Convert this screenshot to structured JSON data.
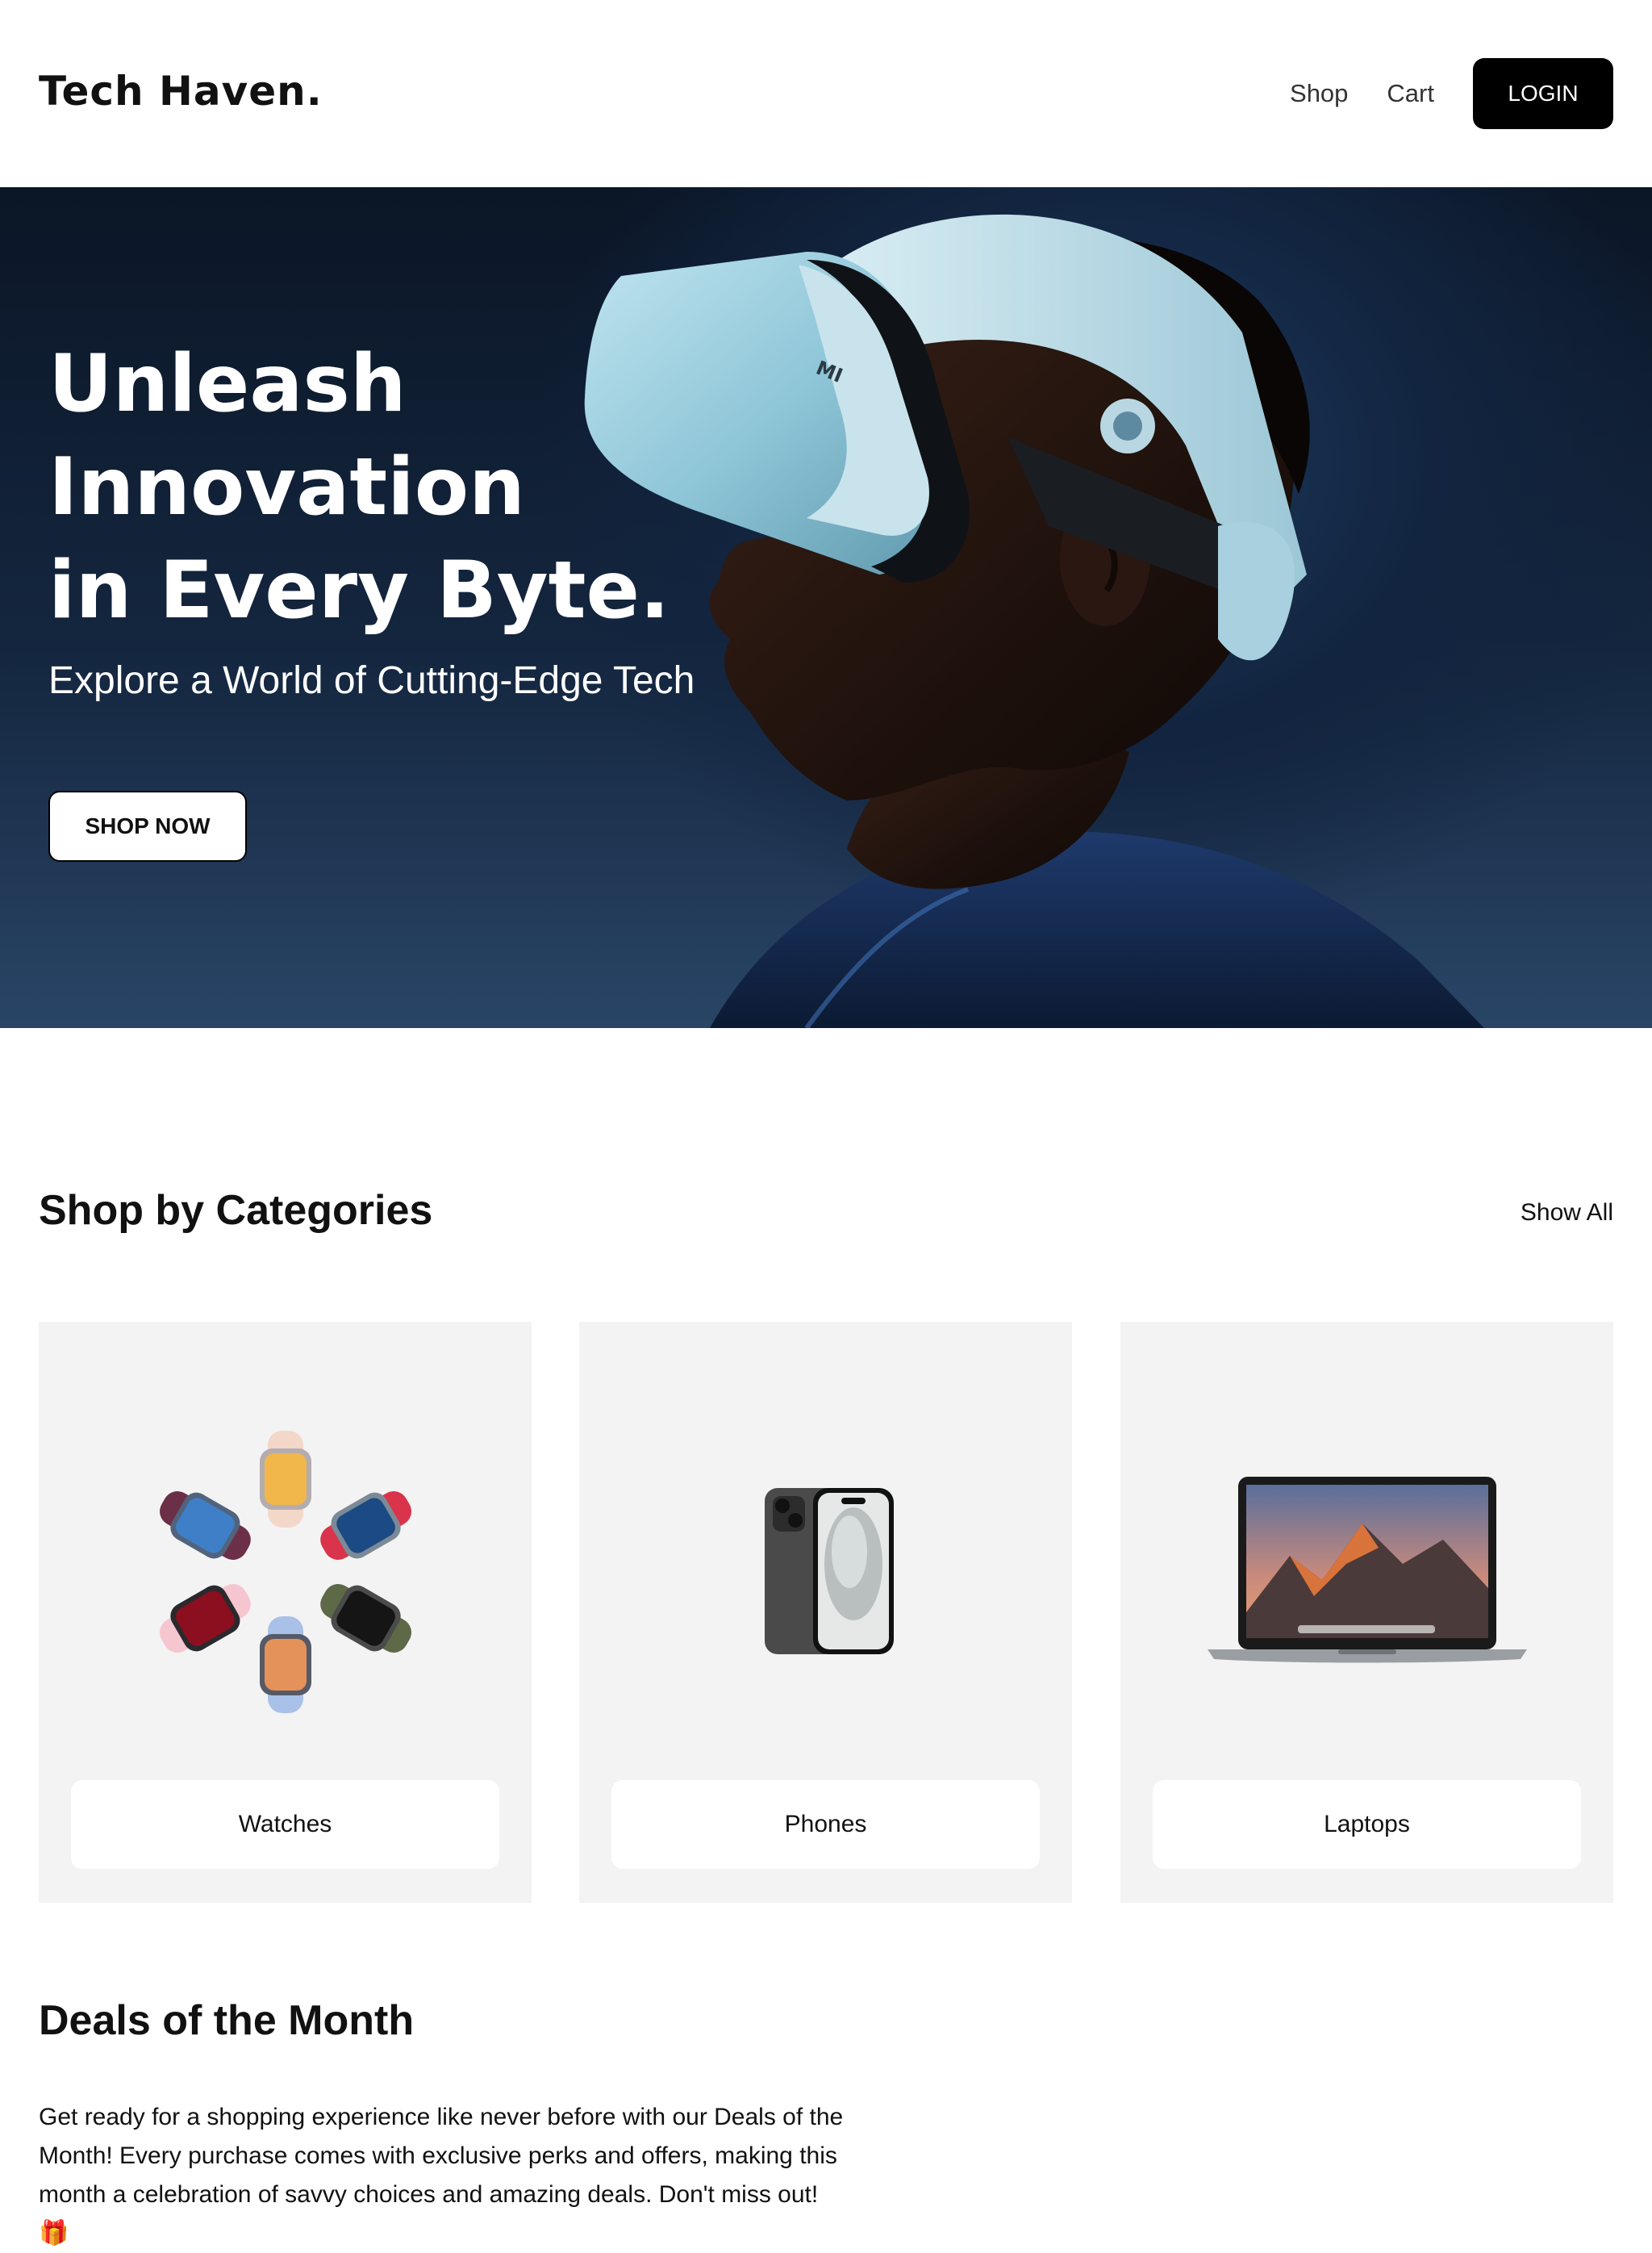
{
  "header": {
    "logo": "Tech Haven.",
    "nav": {
      "shop": "Shop",
      "cart": "Cart"
    },
    "login_label": "LOGIN"
  },
  "hero": {
    "title": "Unleash\nInnovation\nin Every Byte.",
    "subtitle": "Explore a World of Cutting-Edge Tech",
    "cta_label": "SHOP NOW",
    "headset_brand": "MI"
  },
  "categories": {
    "title": "Shop by Categories",
    "show_all": "Show All",
    "items": [
      {
        "label": "Watches",
        "icon": "smartwatch-collection-icon"
      },
      {
        "label": "Phones",
        "icon": "smartphone-icon"
      },
      {
        "label": "Laptops",
        "icon": "laptop-icon"
      }
    ]
  },
  "deals": {
    "title": "Deals of the Month",
    "text": "Get ready for a shopping experience like never before with our Deals of the Month! Every purchase comes with exclusive perks and offers, making this month a celebration of savvy choices and amazing deals. Don't miss out! 🎁"
  },
  "colors": {
    "primary": "#000000",
    "hero_bg": "#12243f",
    "card_bg": "#f3f3f3",
    "text": "#111111"
  }
}
